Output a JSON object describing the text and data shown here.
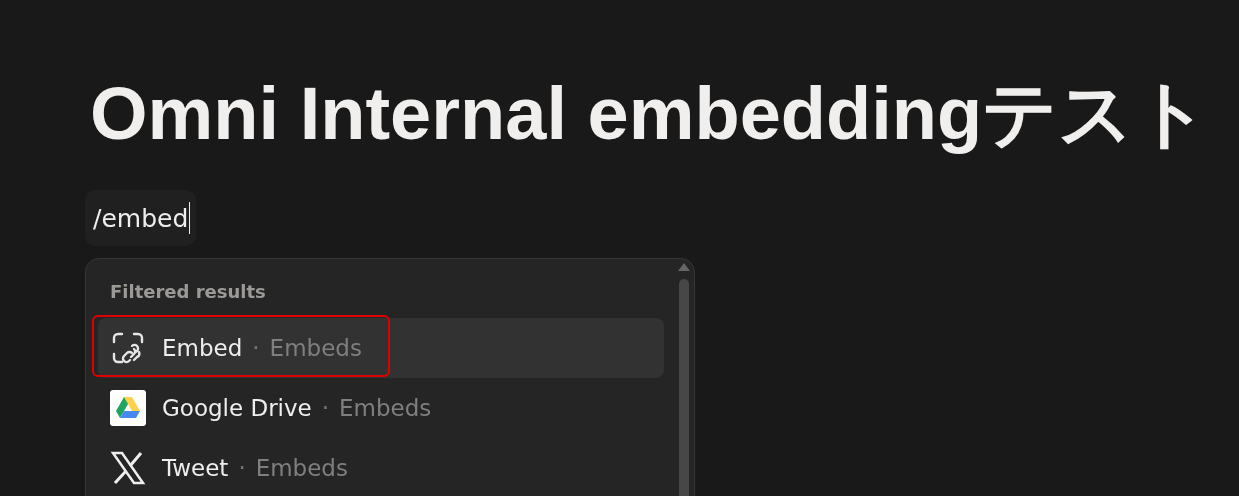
{
  "title": "Omni Internal embeddingテスト",
  "command": {
    "value": "/embed"
  },
  "menu": {
    "heading": "Filtered results",
    "items": [
      {
        "kind": "embed",
        "label": "Embed",
        "separator": "·",
        "category": "Embeds",
        "selected": true,
        "annotated": true
      },
      {
        "kind": "drive",
        "label": "Google Drive",
        "separator": "·",
        "category": "Embeds",
        "selected": false,
        "annotated": false
      },
      {
        "kind": "x",
        "label": "Tweet",
        "separator": "·",
        "category": "Embeds",
        "selected": false,
        "annotated": false
      }
    ]
  }
}
